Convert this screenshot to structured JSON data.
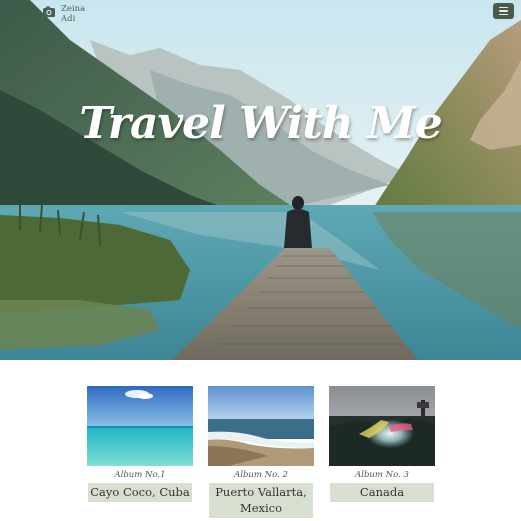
{
  "header": {
    "brand_line1": "Zeina",
    "brand_line2": "Adi",
    "camera_icon": "camera-icon",
    "menu_icon": "hamburger-menu-icon"
  },
  "hero": {
    "title": "Travel With Me"
  },
  "albums": [
    {
      "number_label": "Album No.1",
      "place": "Cayo Coco, Cuba"
    },
    {
      "number_label": "Album No. 2",
      "place": "Puerto Vallarta, Mexico"
    },
    {
      "number_label": "Album No. 3",
      "place": "Canada"
    }
  ],
  "colors": {
    "menu_button": "#4c5a4e",
    "place_badge": "#d6dfd0"
  }
}
